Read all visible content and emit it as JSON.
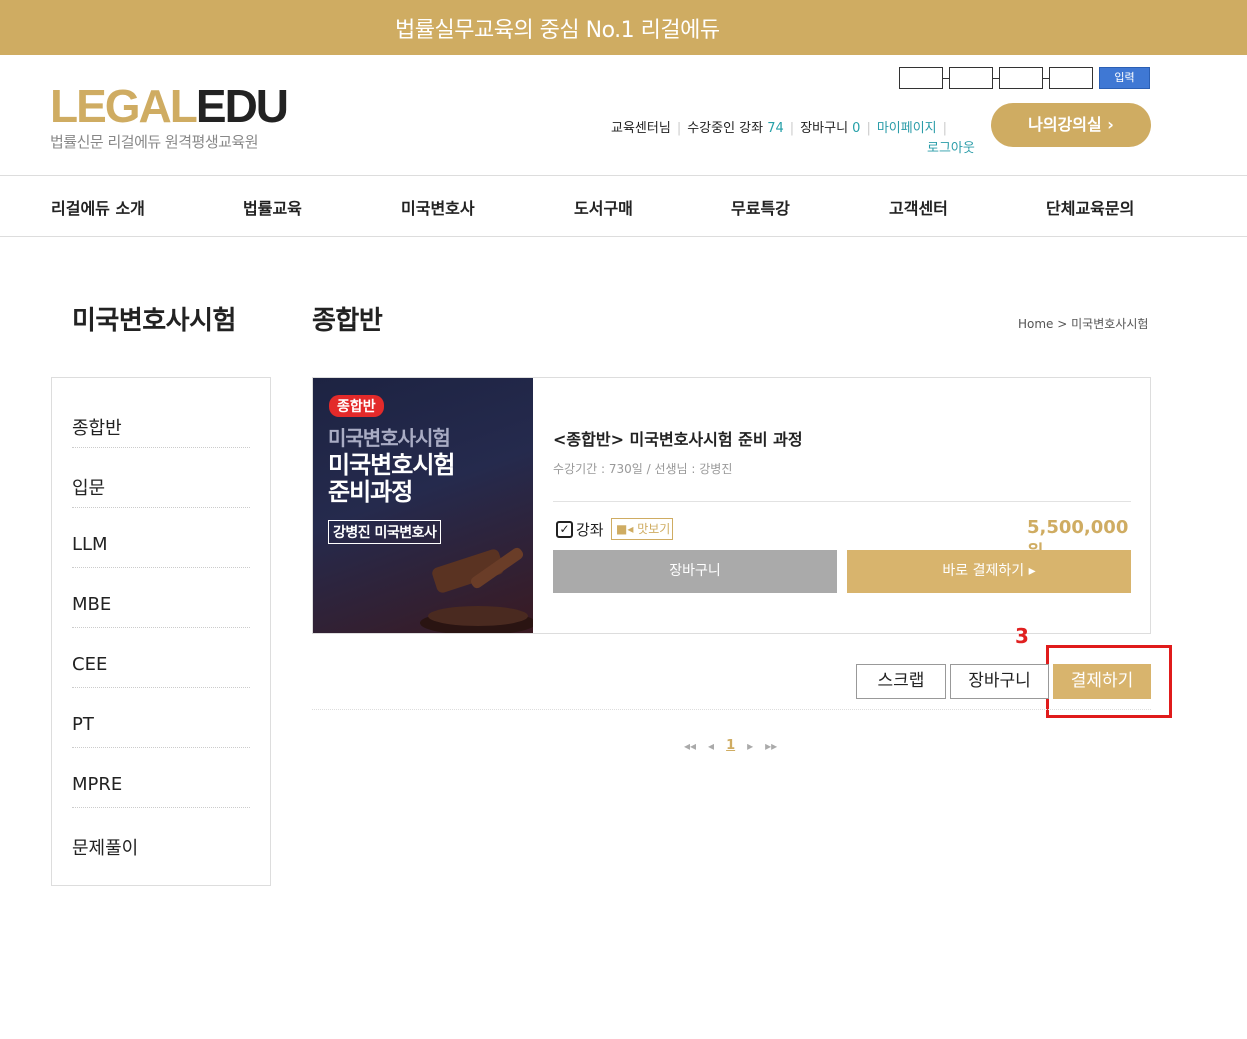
{
  "topbar": {
    "slogan": "법률실무교육의 중심 No.1 리걸에듀"
  },
  "logo": {
    "legal": "LEGAL",
    "edu": "EDU",
    "sub": "법률신문 리걸에듀 원격평생교육원"
  },
  "otp": {
    "enter_label": "입력"
  },
  "userlinks": {
    "center": "교육센터님",
    "courses_label": "수강중인 강좌",
    "courses_count": "74",
    "cart_label": "장바구니",
    "cart_count": "0",
    "mypage": "마이페이지",
    "logout": "로그아웃"
  },
  "mylecture": {
    "label": "나의강의실 ›"
  },
  "nav": [
    "리걸에듀 소개",
    "법률교육",
    "미국변호사",
    "도서구매",
    "무료특강",
    "고객센터",
    "단체교육문의"
  ],
  "side_title": "미국변호사시험",
  "page_title": "종합반",
  "breadcrumb": "Home > 미국변호사시험",
  "sidebar": [
    "종합반",
    "입문",
    "LLM",
    "MBE",
    "CEE",
    "PT",
    "MPRE",
    "문제풀이"
  ],
  "course": {
    "thumb_tag": "종합반",
    "thumb_line1": "미국변호사시험",
    "thumb_line2": "미국변호시험",
    "thumb_line3": "준비과정",
    "thumb_teacher": "강병진 미국변호사",
    "name": "<종합반> 미국변호사시험 준비 과정",
    "meta": "수강기간 : 730일 / 선생님 : 강병진",
    "check_label": "강좌",
    "preview_label": "맛보기",
    "price": "5,500,000 원",
    "cart_button": "장바구니",
    "pay_button": "바로 결제하기 ▸"
  },
  "annotation": {
    "number": "3"
  },
  "actions": {
    "scrap": "스크랩",
    "cart": "장바구니",
    "pay": "결제하기"
  },
  "pager": {
    "first": "◂◂",
    "prev": "◂",
    "current": "1",
    "next": "▸",
    "last": "▸▸"
  },
  "colors": {
    "gold": "#cfac62",
    "button_gold": "#d8b46d",
    "annotation_red": "#e01b1b",
    "link_teal": "#2a9ca8"
  }
}
